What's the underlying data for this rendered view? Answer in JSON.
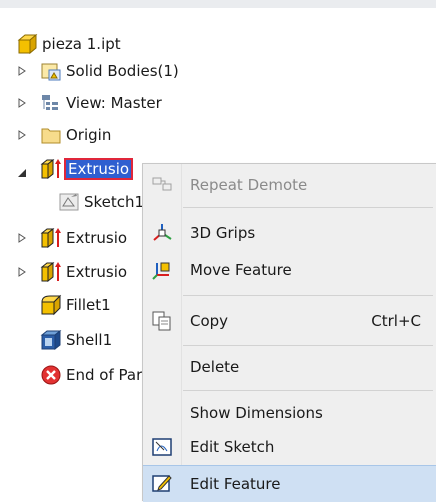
{
  "tree": {
    "root": {
      "label": "pieza 1.ipt",
      "icon": "part-cube-icon"
    },
    "items": [
      {
        "label": "Solid Bodies(1)",
        "icon": "solid-bodies-icon",
        "expander": "collapsed"
      },
      {
        "label": "View: Master",
        "icon": "view-representation-icon",
        "expander": "collapsed"
      },
      {
        "label": "Origin",
        "icon": "folder-icon",
        "expander": "collapsed"
      },
      {
        "label": "Extrusio",
        "icon": "extrusion-icon",
        "expander": "expanded",
        "selected": true
      },
      {
        "label": "Sketch1",
        "icon": "sketch-icon"
      },
      {
        "label": "Extrusio",
        "icon": "extrusion-icon",
        "expander": "collapsed"
      },
      {
        "label": "Extrusio",
        "icon": "extrusion-icon",
        "expander": "collapsed"
      },
      {
        "label": "Fillet1",
        "icon": "fillet-icon"
      },
      {
        "label": "Shell1",
        "icon": "shell-icon"
      },
      {
        "label": "End of Part",
        "icon": "end-of-part-icon"
      }
    ]
  },
  "context_menu": {
    "items": [
      {
        "label": "Repeat Demote",
        "icon": "repeat-demote-icon",
        "disabled": true
      },
      {
        "label": "3D Grips",
        "icon": "3d-grips-icon"
      },
      {
        "label": "Move Feature",
        "icon": "move-feature-icon"
      },
      {
        "label": "Copy",
        "icon": "copy-icon",
        "shortcut": "Ctrl+C"
      },
      {
        "label": "Delete"
      },
      {
        "label": "Show Dimensions"
      },
      {
        "label": "Edit Sketch",
        "icon": "edit-sketch-icon"
      },
      {
        "label": "Edit Feature",
        "icon": "edit-feature-icon",
        "highlighted": true
      }
    ]
  },
  "colors": {
    "selection": "#2f5fd0",
    "selection_outline": "#e0263a",
    "menu_bg": "#efefef",
    "menu_highlight": "#cfe0f3",
    "part_yellow": "#f4c000"
  }
}
